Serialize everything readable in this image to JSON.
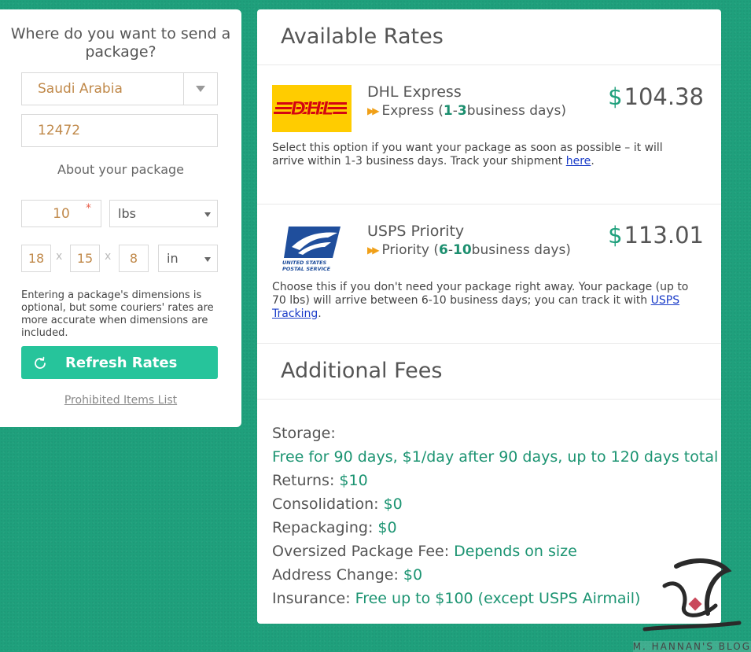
{
  "left": {
    "title": "Where do you want to send a package?",
    "country": "Saudi Arabia",
    "zip": "12472",
    "about_label": "About your package",
    "weight": "10",
    "required_mark": "*",
    "weight_unit": "lbs",
    "dims": [
      "18",
      "15",
      "8"
    ],
    "times_sign": "x",
    "dim_unit": "in",
    "note": "Entering a package's dimensions is optional, but some couriers' rates are more accurate when dimensions are included.",
    "refresh_label": "Refresh Rates",
    "prohibited_label": "Prohibited Items List"
  },
  "rates": {
    "title": "Available Rates",
    "currency": "$",
    "dhl": {
      "logo_text": "DHL",
      "name": "DHL Express",
      "service_prefix": "Express (",
      "days_a": "1",
      "days_sep": "-",
      "days_b": "3",
      "service_suffix": " business days)",
      "price": "104.38",
      "desc": "Select this option if you want your package as soon as possible – it will arrive within 1-3 business days. Track your shipment ",
      "link": "here",
      "desc_end": "."
    },
    "usps": {
      "logo_text_1": "UNITED STATES",
      "logo_text_2": "POSTAL SERVICE",
      "name": "USPS Priority",
      "service_prefix": "Priority (",
      "days_a": "6",
      "days_sep": "-",
      "days_b": "10",
      "service_suffix": " business days)",
      "price": "113.01",
      "desc": "Choose this if you don't need your package right away. Your package (up to 70 lbs) will arrive between 6-10 business days; you can track it with ",
      "link": "USPS Tracking",
      "desc_end": "."
    }
  },
  "fees": {
    "title": "Additional Fees",
    "storage_label": "Storage:",
    "storage_value": "Free for 90 days, $1/day after 90 days, up to 120 days total",
    "items": [
      {
        "label": "Returns:",
        "value": "$10"
      },
      {
        "label": "Consolidation:",
        "value": "$0"
      },
      {
        "label": "Repackaging:",
        "value": "$0"
      },
      {
        "label": "Oversized Package Fee:",
        "value": "Depends on size"
      },
      {
        "label": "Address Change:",
        "value": "$0"
      },
      {
        "label": "Insurance:",
        "value": "Free up to $100 (except USPS Airmail)"
      }
    ]
  },
  "watermark": {
    "text": "M. HANNAN'S BLOG"
  },
  "colors": {
    "background": "#1fa07c",
    "accent": "#26c49b",
    "value_green": "#1c9472",
    "dhl_yellow": "#ffcc00",
    "dhl_red": "#d40511",
    "usps_blue": "#1f4e9c"
  }
}
